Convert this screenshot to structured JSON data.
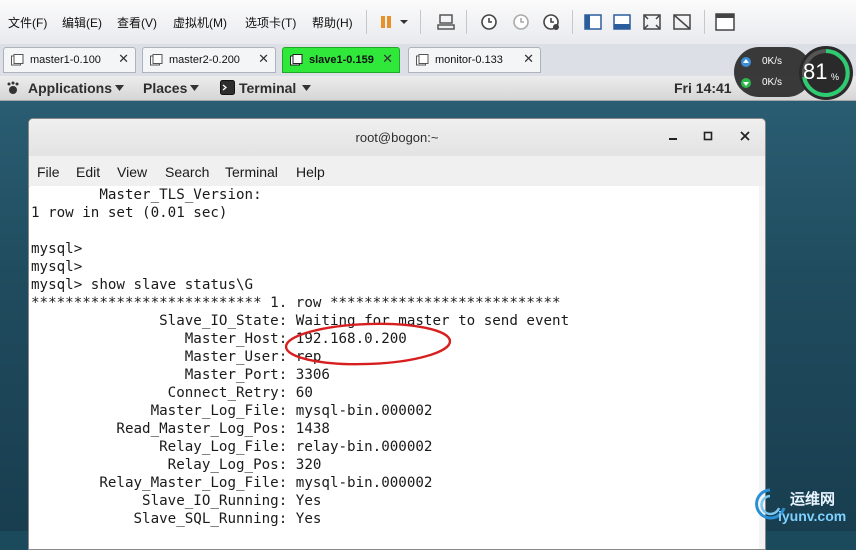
{
  "vm_menu": [
    "文件(F)",
    "编辑(E)",
    "查看(V)",
    "虚拟机(M)",
    "选项卡(T)",
    "帮助(H)"
  ],
  "vm_tabs": [
    {
      "label": "master1-0.100"
    },
    {
      "label": "master2-0.200"
    },
    {
      "label": "slave1-0.159",
      "active": true
    },
    {
      "label": "monitor-0.133"
    }
  ],
  "gnome": {
    "applications": "Applications",
    "places": "Places",
    "terminal": "Terminal",
    "clock": "Fri 14:41"
  },
  "gauge": {
    "up": "0K/s",
    "down": "0K/s",
    "percent": "81",
    "percent_sign": "%"
  },
  "terminal": {
    "title": "root@bogon:~",
    "menu": [
      "File",
      "Edit",
      "View",
      "Search",
      "Terminal",
      "Help"
    ],
    "lines": [
      "        Master_TLS_Version:",
      "1 row in set (0.01 sec)",
      "",
      "mysql>",
      "mysql>",
      "mysql> show slave status\\G",
      "*************************** 1. row ***************************",
      "               Slave_IO_State: Waiting for master to send event",
      "                  Master_Host: 192.168.0.200",
      "                  Master_User: rep",
      "                  Master_Port: 3306",
      "                Connect_Retry: 60",
      "              Master_Log_File: mysql-bin.000002",
      "          Read_Master_Log_Pos: 1438",
      "               Relay_Log_File: relay-bin.000002",
      "                Relay_Log_Pos: 320",
      "        Relay_Master_Log_File: mysql-bin.000002",
      "             Slave_IO_Running: Yes",
      "            Slave_SQL_Running: Yes"
    ]
  },
  "watermark": {
    "cn": "运维网",
    "url": "iyunv.com"
  },
  "colors": {
    "active_tab": "#2fe83a",
    "annotation": "#d81f1f"
  }
}
